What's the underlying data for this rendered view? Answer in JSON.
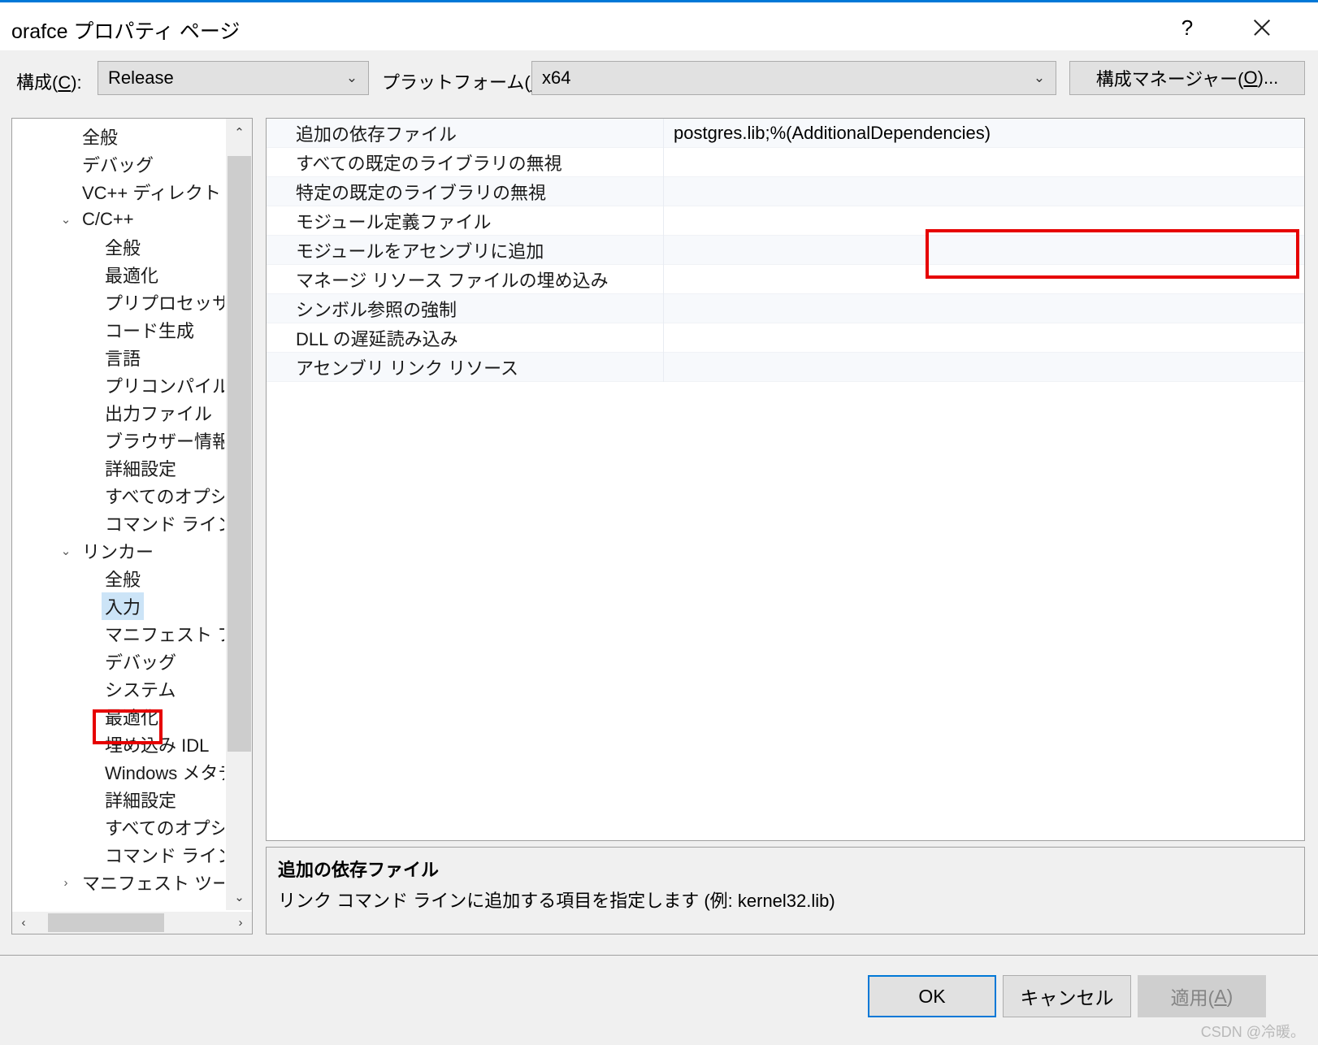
{
  "window": {
    "title": "orafce プロパティ ページ",
    "help_label": "?",
    "close_label": "×",
    "accent_color": "#0078d7",
    "annotation_color": "#e60000",
    "selection_color": "#cce4f7"
  },
  "toolbar": {
    "config_label": "構成(C):",
    "config_value": "Release",
    "platform_label": "プラットフォーム(P):",
    "platform_value": "x64",
    "config_manager_button": "構成マネージャー(O)...",
    "dropdown_arrow": "⌄"
  },
  "tree": {
    "scroll_up": "⌃",
    "scroll_down": "⌄",
    "scroll_left": "‹",
    "scroll_right": "›",
    "expanded_chevron": "⌄",
    "collapsed_chevron": "›",
    "selected": "入力",
    "nodes": [
      {
        "label": "全般",
        "level": 0,
        "chevron": ""
      },
      {
        "label": "デバッグ",
        "level": 0,
        "chevron": ""
      },
      {
        "label": "VC++ ディレクトリ",
        "level": 0,
        "chevron": ""
      },
      {
        "label": "C/C++",
        "level": 0,
        "chevron": "expanded"
      },
      {
        "label": "全般",
        "level": 1,
        "chevron": ""
      },
      {
        "label": "最適化",
        "level": 1,
        "chevron": ""
      },
      {
        "label": "プリプロセッサ",
        "level": 1,
        "chevron": ""
      },
      {
        "label": "コード生成",
        "level": 1,
        "chevron": ""
      },
      {
        "label": "言語",
        "level": 1,
        "chevron": ""
      },
      {
        "label": "プリコンパイル済み",
        "level": 1,
        "chevron": ""
      },
      {
        "label": "出力ファイル",
        "level": 1,
        "chevron": ""
      },
      {
        "label": "ブラウザー情報",
        "level": 1,
        "chevron": ""
      },
      {
        "label": "詳細設定",
        "level": 1,
        "chevron": ""
      },
      {
        "label": "すべてのオプション",
        "level": 1,
        "chevron": ""
      },
      {
        "label": "コマンド ライン",
        "level": 1,
        "chevron": ""
      },
      {
        "label": "リンカー",
        "level": 0,
        "chevron": "expanded"
      },
      {
        "label": "全般",
        "level": 1,
        "chevron": ""
      },
      {
        "label": "入力",
        "level": 1,
        "chevron": "",
        "selected": true
      },
      {
        "label": "マニフェスト ファイル",
        "level": 1,
        "chevron": ""
      },
      {
        "label": "デバッグ",
        "level": 1,
        "chevron": ""
      },
      {
        "label": "システム",
        "level": 1,
        "chevron": ""
      },
      {
        "label": "最適化",
        "level": 1,
        "chevron": ""
      },
      {
        "label": "埋め込み IDL",
        "level": 1,
        "chevron": ""
      },
      {
        "label": "Windows メタデータ",
        "level": 1,
        "chevron": ""
      },
      {
        "label": "詳細設定",
        "level": 1,
        "chevron": ""
      },
      {
        "label": "すべてのオプション",
        "level": 1,
        "chevron": ""
      },
      {
        "label": "コマンド ライン",
        "level": 1,
        "chevron": ""
      },
      {
        "label": "マニフェスト ツール",
        "level": 0,
        "chevron": "collapsed"
      }
    ]
  },
  "grid": {
    "rows": [
      {
        "name": "追加の依存ファイル",
        "value": "postgres.lib;%(AdditionalDependencies)"
      },
      {
        "name": "すべての既定のライブラリの無視",
        "value": ""
      },
      {
        "name": "特定の既定のライブラリの無視",
        "value": ""
      },
      {
        "name": "モジュール定義ファイル",
        "value": ""
      },
      {
        "name": "モジュールをアセンブリに追加",
        "value": ""
      },
      {
        "name": "マネージ リソース ファイルの埋め込み",
        "value": ""
      },
      {
        "name": "シンボル参照の強制",
        "value": ""
      },
      {
        "name": "DLL の遅延読み込み",
        "value": ""
      },
      {
        "name": "アセンブリ リンク リソース",
        "value": ""
      }
    ]
  },
  "description": {
    "title": "追加の依存ファイル",
    "body": "リンク コマンド ラインに追加する項目を指定します (例: kernel32.lib)"
  },
  "footer": {
    "ok": "OK",
    "cancel": "キャンセル",
    "apply_prefix": "適用(",
    "apply_key": "A",
    "apply_suffix": ")",
    "watermark": "CSDN @冷暖。"
  }
}
